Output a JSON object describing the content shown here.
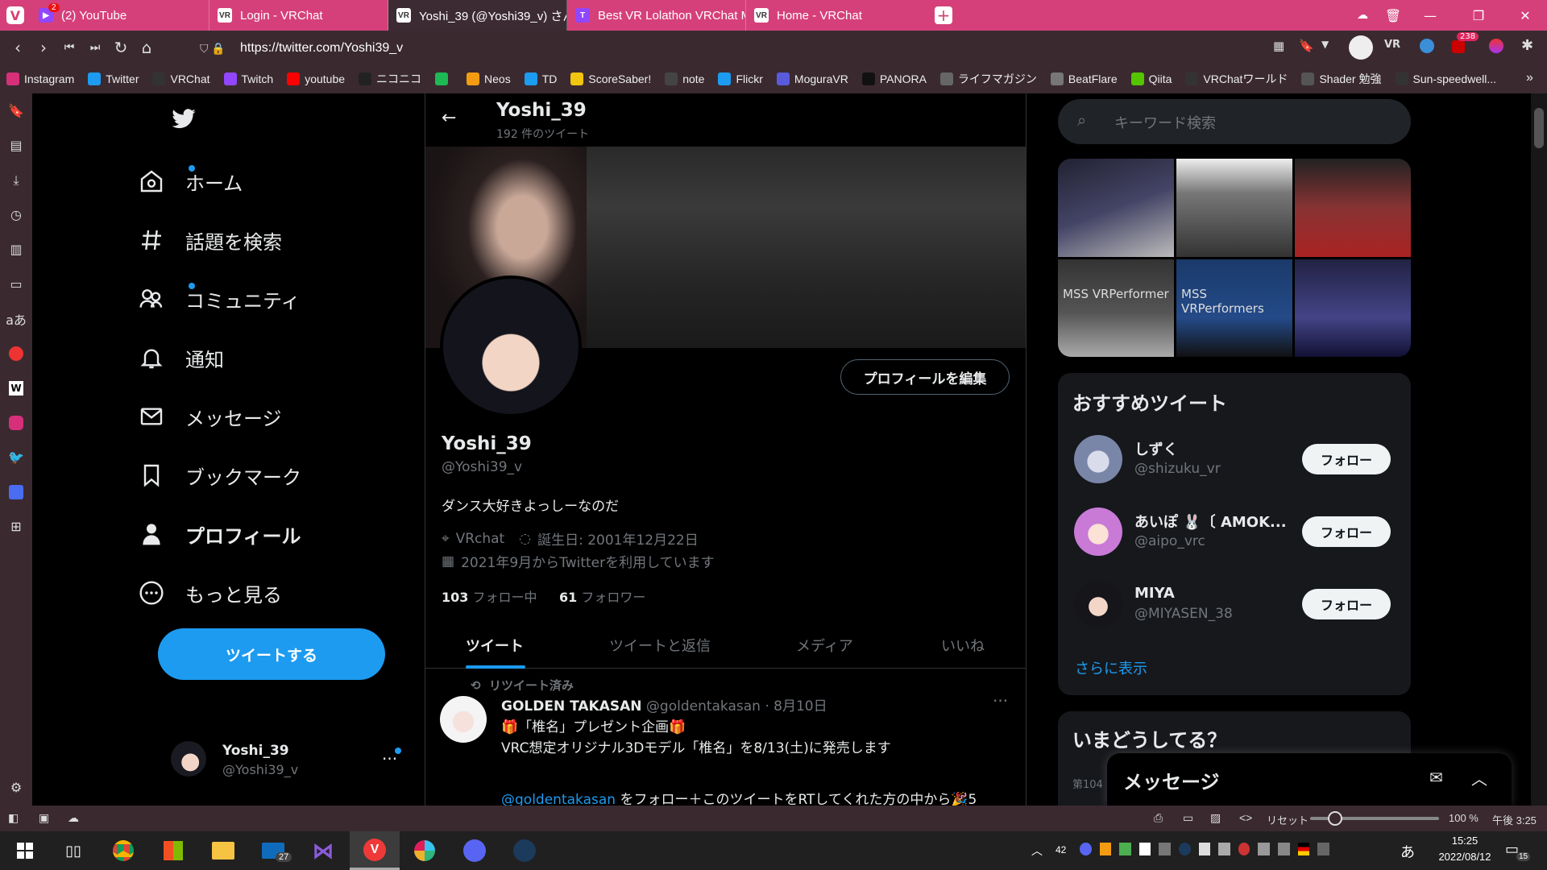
{
  "browser": {
    "tabs": [
      {
        "title": "(2) YouTube",
        "badge": "2",
        "icon": "youtube-icon"
      },
      {
        "title": "Login - VRChat",
        "icon": "vrchat-icon"
      },
      {
        "title": "Yoshi_39 (@Yoshi39_v) さん",
        "icon": "vrchat-icon"
      },
      {
        "title": "Best VR Lolathon VRChat M",
        "icon": "twitch-icon"
      },
      {
        "title": "Home - VRChat",
        "icon": "vrchat-icon"
      }
    ],
    "url": "https://twitter.com/Yoshi39_v",
    "extension_badge": "238",
    "bookmarks": [
      {
        "label": "Instagram",
        "color": "#d6307a"
      },
      {
        "label": "Twitter",
        "color": "#1d9bf0"
      },
      {
        "label": "VRChat",
        "color": "#333"
      },
      {
        "label": "Twitch",
        "color": "#9146ff"
      },
      {
        "label": "youtube",
        "color": "#f00"
      },
      {
        "label": "ニコニコ",
        "color": "#222"
      },
      {
        "label": "",
        "color": "#1db954"
      },
      {
        "label": "Neos",
        "color": "#f39c12"
      },
      {
        "label": "TD",
        "color": "#1d9bf0"
      },
      {
        "label": "ScoreSaber!",
        "color": "#f1c40f"
      },
      {
        "label": "note",
        "color": "#444"
      },
      {
        "label": "Flickr",
        "color": "#1d9bf0"
      },
      {
        "label": "MoguraVR",
        "color": "#5a5adc"
      },
      {
        "label": "PANORA",
        "color": "#111"
      },
      {
        "label": "ライフマガジン",
        "color": "#666"
      },
      {
        "label": "BeatFlare",
        "color": "#777"
      },
      {
        "label": "Qiita",
        "color": "#55c500"
      },
      {
        "label": "VRChatワールド",
        "color": "#333"
      },
      {
        "label": "Shader 勉強",
        "color": "#555"
      },
      {
        "label": "Sun-speedwell...",
        "color": "#333"
      }
    ],
    "status": {
      "reset": "リセット",
      "zoom": "100 %",
      "time": "午後 3:25"
    }
  },
  "sidebar": {
    "items": [
      {
        "label": "ホーム",
        "icon": "home-icon",
        "dot": true
      },
      {
        "label": "話題を検索",
        "icon": "hashtag-icon"
      },
      {
        "label": "コミュニティ",
        "icon": "communities-icon",
        "dot": true
      },
      {
        "label": "通知",
        "icon": "bell-icon"
      },
      {
        "label": "メッセージ",
        "icon": "mail-icon"
      },
      {
        "label": "ブックマーク",
        "icon": "bookmark-icon"
      },
      {
        "label": "プロフィール",
        "icon": "person-icon"
      },
      {
        "label": "もっと見る",
        "icon": "more-circle-icon"
      }
    ],
    "tweet_button": "ツイートする",
    "account": {
      "name": "Yoshi_39",
      "handle": "@Yoshi39_v"
    }
  },
  "profile": {
    "header_name": "Yoshi_39",
    "tweet_count": "192 件のツイート",
    "name": "Yoshi_39",
    "handle": "@Yoshi39_v",
    "bio": "ダンス大好きよっしーなのだ",
    "location": "VRchat",
    "birthday": "誕生日: 2001年12月22日",
    "joined": "2021年9月からTwitterを利用しています",
    "following_count": "103",
    "following_label": "フォロー中",
    "followers_count": "61",
    "followers_label": "フォロワー",
    "edit_button": "プロフィールを編集",
    "tabs": [
      "ツイート",
      "ツイートと返信",
      "メディア",
      "いいね"
    ]
  },
  "tweet": {
    "retweet_label": "リツイート済み",
    "author": "GOLDEN TAKASAN",
    "handle": "@goldentakasan",
    "date": "· 8月10日",
    "line1": "🎁「椎名」プレゼント企画🎁",
    "line2": "VRC想定オリジナル3Dモデル「椎名」を8/13(土)に発売します",
    "mention": "@goldentakasan",
    "line3": "をフォロー＋このツイートをRTしてくれた方の中から🎉5"
  },
  "right": {
    "search_placeholder": "キーワード検索",
    "media_tiles": [
      "MSS VRPerformer",
      "MSS VRPerformers"
    ],
    "recommend_title": "おすすめツイート",
    "users": [
      {
        "name": "しずく",
        "handle": "@shizuku_vr",
        "follow": "フォロー"
      },
      {
        "name": "あいぽ 🐰〔 AMOK...",
        "handle": "@aipo_vrc",
        "follow": "フォロー"
      },
      {
        "name": "MIYA",
        "handle": "@MIYASEN_38",
        "follow": "フォロー"
      }
    ],
    "show_more": "さらに表示",
    "trending_title": "いまどうしてる？",
    "trending_snippet": "第104",
    "messages_title": "メッセージ"
  },
  "taskbar": {
    "mail_badge": "27",
    "tray_count": "42",
    "time": "15:25",
    "date": "2022/08/12",
    "notif": "15",
    "ime": "あ"
  }
}
